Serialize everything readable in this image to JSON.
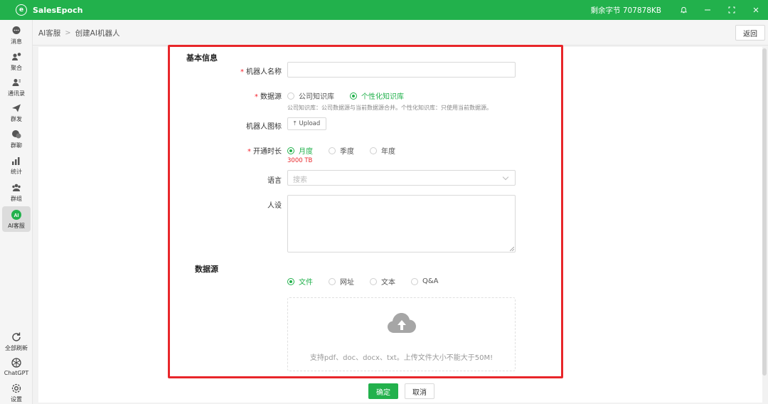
{
  "app": {
    "name": "SalesEpoch",
    "logo_glyph": "e",
    "quota": "剩余字节 707878KB"
  },
  "sidebar": {
    "items": [
      {
        "label": "消息",
        "icon": "chat-bubble-icon"
      },
      {
        "label": "聚合",
        "icon": "users-chat-icon"
      },
      {
        "label": "通讯录",
        "icon": "contacts-icon"
      },
      {
        "label": "群发",
        "icon": "paper-plane-icon"
      },
      {
        "label": "群聊",
        "icon": "group-chat-icon"
      },
      {
        "label": "统计",
        "icon": "bar-chart-icon"
      },
      {
        "label": "群组",
        "icon": "group-icon"
      },
      {
        "label": "AI客服",
        "icon": "ai-icon",
        "active": true
      }
    ],
    "bottom_items": [
      {
        "label": "全部刷新",
        "icon": "refresh-icon"
      },
      {
        "label": "ChatGPT",
        "icon": "chatgpt-icon"
      },
      {
        "label": "设置",
        "icon": "settings-icon"
      }
    ]
  },
  "breadcrumb": {
    "root": "AI客服",
    "current": "创建AI机器人"
  },
  "back_label": "返回",
  "form": {
    "basic_title": "基本信息",
    "name_label": "机器人名称",
    "name_value": "",
    "datasource_label": "数据源",
    "datasource_options": [
      "公司知识库",
      "个性化知识库"
    ],
    "datasource_selected": "个性化知识库",
    "datasource_hint": "公司知识库：公司数据源与当前数据源合并。个性化知识库：只使用当前数据源。",
    "icon_label": "机器人图标",
    "upload_label": "Upload",
    "duration_label": "开通时长",
    "duration_options": [
      "月度",
      "季度",
      "年度"
    ],
    "duration_selected": "月度",
    "duration_price": "3000 TB",
    "language_label": "语言",
    "language_placeholder": "搜索",
    "persona_label": "人设",
    "persona_value": ""
  },
  "datasource_section": {
    "title": "数据源",
    "options": [
      "文件",
      "网址",
      "文本",
      "Q&A"
    ],
    "selected": "文件",
    "upload_hint": "支持pdf、doc、docx、txt。上传文件大小不能大于50M!"
  },
  "actions": {
    "confirm": "确定",
    "cancel": "取消"
  },
  "colors": {
    "brand": "#22b14c",
    "highlight": "#e8262a",
    "required": "#f5222d"
  }
}
